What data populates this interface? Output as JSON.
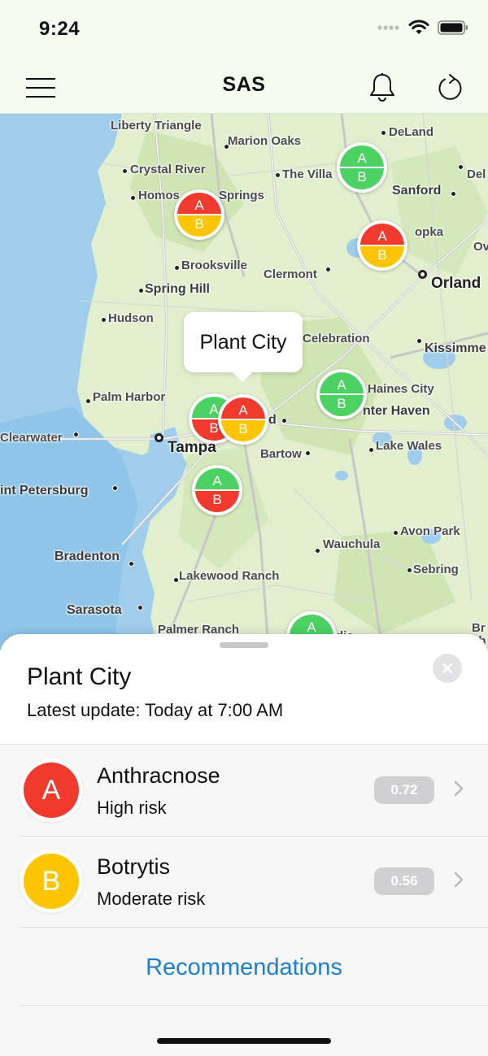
{
  "status_bar": {
    "time": "9:24"
  },
  "nav": {
    "title": "SAS",
    "menu_icon": "hamburger-menu-icon",
    "bell_icon": "bell-icon",
    "refresh_icon": "refresh-icon"
  },
  "map": {
    "places": [
      "Liberty Triangle",
      "DeLand",
      "Marion Oaks",
      "Crystal River",
      "The Villa",
      "Del",
      "Homos",
      "Springs",
      "Sanford",
      "opka",
      "Ov",
      "Brooksville",
      "Clermont",
      "Orland",
      "Spring Hill",
      "Hudson",
      "Celebration",
      "Kissimme",
      "Haines City",
      "Palm Harbor",
      "nter Haven",
      "d",
      "Clearwater",
      "Tampa",
      "Bartow",
      "Lake Wales",
      "int Petersburg",
      "Avon Park",
      "Wauchula",
      "Bradenton",
      "Sebring",
      "Lakewood Ranch",
      "Sarasota",
      "Palmer Ranch",
      "Br",
      "ch",
      "dia"
    ],
    "callout": "Plant City",
    "marker_letters": {
      "top": "A",
      "bottom": "B"
    },
    "colors": {
      "high": "#f03a2e",
      "moderate": "#fcc500",
      "low": "#4cd263"
    }
  },
  "sheet": {
    "title": "Plant City",
    "subtitle": "Latest update: Today at 7:00 AM",
    "close_icon": "close-icon",
    "risks": [
      {
        "letter": "A",
        "name": "Anthracnose",
        "level": "High risk",
        "score": "0.72",
        "color": "#f03a2e"
      },
      {
        "letter": "B",
        "name": "Botrytis",
        "level": "Moderate risk",
        "score": "0.56",
        "color": "#fcc500"
      }
    ],
    "recommendations_label": "Recommendations"
  }
}
